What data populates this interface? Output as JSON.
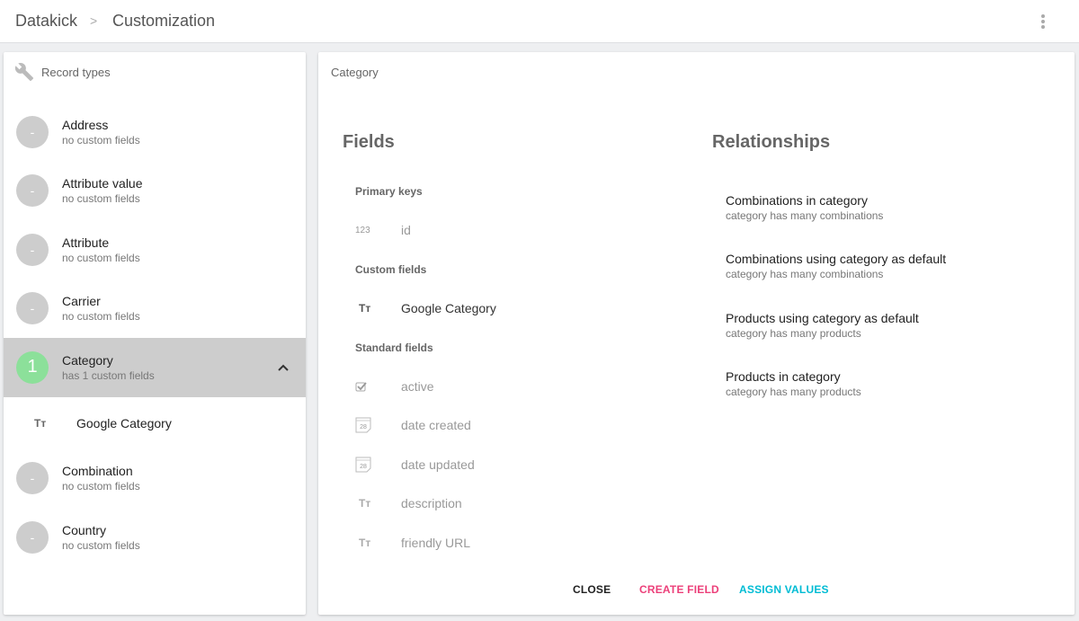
{
  "header": {
    "breadcrumb_root": "Datakick",
    "breadcrumb_separator": ">",
    "breadcrumb_current": "Customization",
    "menu_icon": "more-vert-icon"
  },
  "sidebar": {
    "title": "Record types",
    "title_icon": "wrench-icon",
    "items": [
      {
        "avatar": "-",
        "name": "Address",
        "subtitle": "no custom fields"
      },
      {
        "avatar": "-",
        "name": "Attribute value",
        "subtitle": "no custom fields"
      },
      {
        "avatar": "-",
        "name": "Attribute",
        "subtitle": "no custom fields"
      },
      {
        "avatar": "-",
        "name": "Carrier",
        "subtitle": "no custom fields"
      },
      {
        "avatar": "1",
        "name": "Category",
        "subtitle": "has 1 custom fields",
        "selected": true,
        "expanded": true,
        "children": [
          {
            "icon": "Tт",
            "name": "Google Category"
          }
        ]
      },
      {
        "avatar": "-",
        "name": "Combination",
        "subtitle": "no custom fields"
      },
      {
        "avatar": "-",
        "name": "Country",
        "subtitle": "no custom fields"
      }
    ]
  },
  "detail": {
    "title": "Category",
    "fields_heading": "Fields",
    "relationships_heading": "Relationships",
    "groups": {
      "primary": {
        "label": "Primary keys",
        "fields": [
          {
            "icon": "123",
            "name": "id"
          }
        ]
      },
      "custom": {
        "label": "Custom fields",
        "fields": [
          {
            "icon": "Tт",
            "name": "Google Category"
          }
        ]
      },
      "standard": {
        "label": "Standard fields",
        "fields": [
          {
            "icon": "checkbox",
            "name": "active"
          },
          {
            "icon": "28",
            "name": "date created"
          },
          {
            "icon": "28",
            "name": "date updated"
          },
          {
            "icon": "Tт",
            "name": "description"
          },
          {
            "icon": "Tт",
            "name": "friendly URL"
          }
        ]
      }
    },
    "relationships": [
      {
        "name": "Combinations in category",
        "description": "category has many combinations"
      },
      {
        "name": "Combinations using category as default",
        "description": "category has many combinations"
      },
      {
        "name": "Products using category as default",
        "description": "category has many products"
      },
      {
        "name": "Products in category",
        "description": "category has many products"
      }
    ],
    "actions": {
      "close": "CLOSE",
      "create_field": "CREATE FIELD",
      "assign_values": "ASSIGN VALUES"
    },
    "colors": {
      "create_field": "#ec407a",
      "assign_values": "#00bcd4",
      "badge_active": "#8ce09a"
    }
  }
}
